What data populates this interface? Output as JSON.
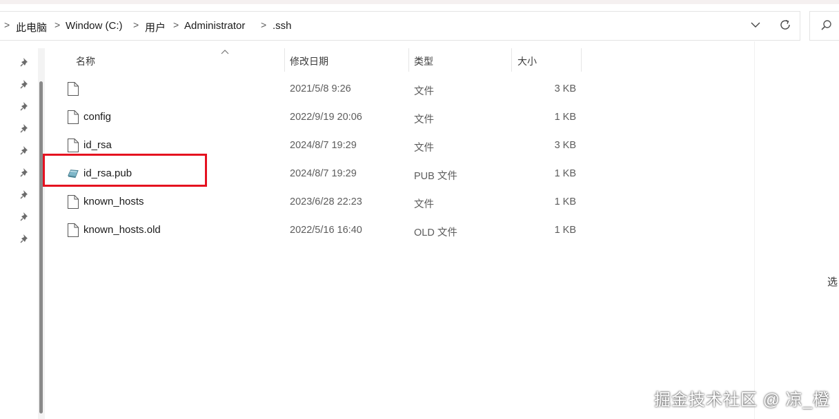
{
  "breadcrumb": {
    "items": [
      "此电脑",
      "Window (C:)",
      "用户",
      "Administrator",
      ".ssh"
    ],
    "separator": ">"
  },
  "address_actions": {
    "dropdown_icon": "chevron-down-icon",
    "refresh_icon": "refresh-icon",
    "search_icon": "search-icon"
  },
  "columns": {
    "name": "名称",
    "modified": "修改日期",
    "type": "类型",
    "size": "大小"
  },
  "files": [
    {
      "name": "",
      "modified": "2021/5/8 9:26",
      "type": "文件",
      "size": "3 KB",
      "icon": "file-icon"
    },
    {
      "name": "config",
      "modified": "2022/9/19 20:06",
      "type": "文件",
      "size": "1 KB",
      "icon": "file-icon"
    },
    {
      "name": "id_rsa",
      "modified": "2024/8/7 19:29",
      "type": "文件",
      "size": "3 KB",
      "icon": "file-icon"
    },
    {
      "name": "id_rsa.pub",
      "modified": "2024/8/7 19:29",
      "type": "PUB 文件",
      "size": "1 KB",
      "icon": "publisher-file-icon"
    },
    {
      "name": "known_hosts",
      "modified": "2023/6/28 22:23",
      "type": "文件",
      "size": "1 KB",
      "icon": "file-icon"
    },
    {
      "name": "known_hosts.old",
      "modified": "2022/5/16 16:40",
      "type": "OLD 文件",
      "size": "1 KB",
      "icon": "file-icon"
    }
  ],
  "highlight_color": "#e5101f",
  "side_text": "选",
  "watermark": "掘金技术社区 @ 凉_橙"
}
